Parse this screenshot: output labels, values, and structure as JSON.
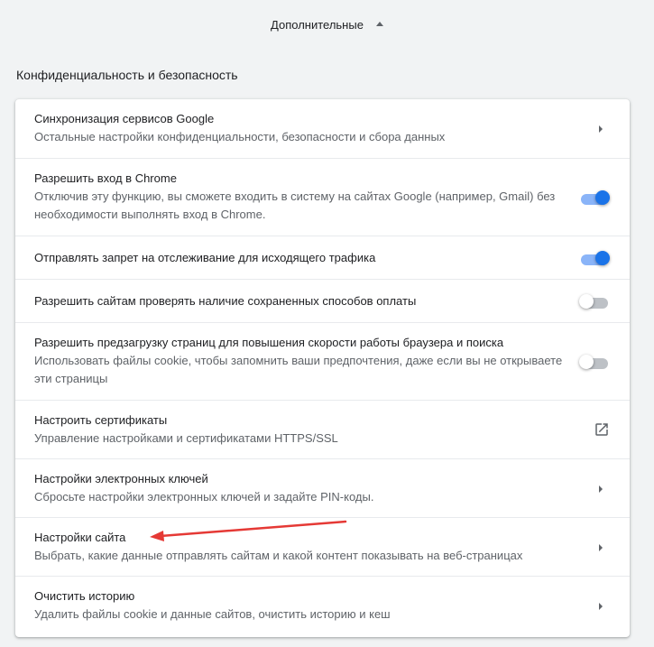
{
  "advanced": {
    "label": "Дополнительные",
    "icon": "caret-up-icon"
  },
  "section": {
    "title": "Конфиденциальность и безопасность"
  },
  "rows": [
    {
      "title": "Синхронизация сервисов Google",
      "sub": "Остальные настройки конфиденциальности, безопасности и сбора данных",
      "control": "chevron"
    },
    {
      "title": "Разрешить вход в Chrome",
      "sub": "Отключив эту функцию, вы сможете входить в систему на сайтах Google (например, Gmail) без необходимости выполнять вход в Chrome.",
      "control": "toggle",
      "checked": true
    },
    {
      "title": "Отправлять запрет на отслеживание для исходящего трафика",
      "control": "toggle",
      "checked": true
    },
    {
      "title": "Разрешить сайтам проверять наличие сохраненных способов оплаты",
      "control": "toggle",
      "checked": false
    },
    {
      "title": "Разрешить предзагрузку страниц для повышения скорости работы браузера и поиска",
      "sub": "Использовать файлы cookie, чтобы запомнить ваши предпочтения, даже если вы не открываете эти страницы",
      "control": "toggle",
      "checked": false
    },
    {
      "title": "Настроить сертификаты",
      "sub": "Управление настройками и сертификатами HTTPS/SSL",
      "control": "external-link"
    },
    {
      "title": "Настройки электронных ключей",
      "sub": "Сбросьте настройки электронных ключей и задайте PIN-коды.",
      "control": "chevron"
    },
    {
      "title": "Настройки сайта",
      "sub": "Выбрать, какие данные отправлять сайтам и какой контент показывать на веб-страницах",
      "control": "chevron"
    },
    {
      "title": "Очистить историю",
      "sub": "Удалить файлы cookie и данные сайтов, очистить историю и кеш",
      "control": "chevron"
    }
  ],
  "colors": {
    "background": "#f1f3f4",
    "card": "#ffffff",
    "toggle_on": "#1a73e8",
    "toggle_on_track": "#8ab4f8",
    "toggle_off_track": "#bdc1c6",
    "annotation_arrow": "#e53935"
  }
}
